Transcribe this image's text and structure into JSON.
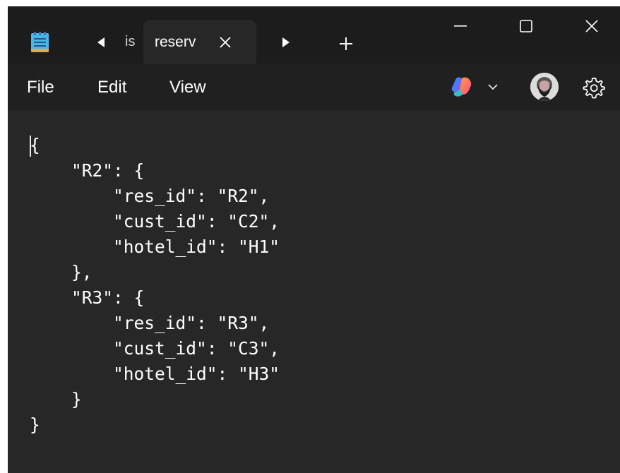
{
  "titlebar": {
    "tabs": [
      {
        "label": "is",
        "state": "inactive-partial"
      },
      {
        "label": "reserv",
        "state": "active"
      }
    ],
    "new_tab_label": "+",
    "icons": {
      "app": "notepad-icon",
      "prev_tab": "caret-left-icon",
      "next_tab": "caret-right-icon",
      "close_tab": "close-icon",
      "minimize": "minimize-icon",
      "maximize": "maximize-icon",
      "close_window": "close-icon"
    }
  },
  "menubar": {
    "file_label": "File",
    "edit_label": "Edit",
    "view_label": "View",
    "icons": {
      "copilot": "copilot-icon",
      "chevron": "chevron-down-icon",
      "avatar": "avatar",
      "settings": "gear-icon"
    }
  },
  "editor": {
    "lines": [
      "{",
      "    \"R2\": {",
      "        \"res_id\": \"R2\",",
      "        \"cust_id\": \"C2\",",
      "        \"hotel_id\": \"H1\"",
      "    },",
      "    \"R3\": {",
      "        \"res_id\": \"R3\",",
      "        \"cust_id\": \"C3\",",
      "        \"hotel_id\": \"H3\"",
      "    }",
      "}"
    ]
  },
  "colors": {
    "titlebar_bg": "#1c1c1c",
    "menubar_bg": "#202020",
    "editor_bg": "#272727",
    "text": "#ffffff",
    "notepad_icon_blue": "#4ab5e8"
  }
}
